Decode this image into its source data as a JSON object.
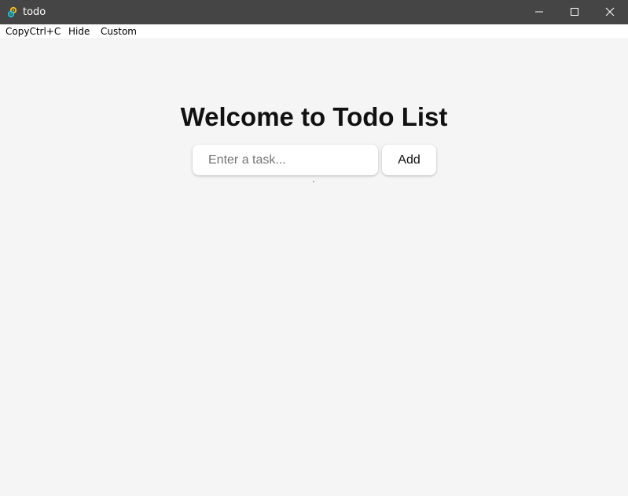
{
  "window": {
    "title": "todo",
    "icon": "tauri-app-icon",
    "controls": [
      "minimize-icon",
      "maximize-icon",
      "close-icon"
    ]
  },
  "menu": {
    "items": [
      {
        "label": "CopyCtrl+C"
      },
      {
        "label": "Hide"
      },
      {
        "label": "Custom"
      }
    ]
  },
  "main": {
    "heading": "Welcome to Todo List",
    "task_input": {
      "placeholder": "Enter a task...",
      "value": ""
    },
    "add_button_label": "Add"
  },
  "colors": {
    "titlebar": "#454545",
    "background": "#f5f5f5",
    "surface": "#ffffff"
  }
}
